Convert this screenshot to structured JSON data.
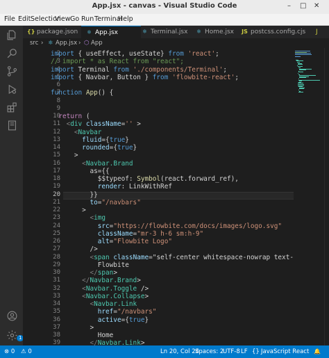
{
  "window": {
    "title": "App.jsx - canvas - Visual Studio Code",
    "minimize": "–",
    "maximize": "□",
    "close": "✕"
  },
  "menu": [
    "File",
    "Edit",
    "Selection",
    "View",
    "Go",
    "Run",
    "Terminal",
    "Help"
  ],
  "tabs": [
    {
      "label": "package.json",
      "icon": "{}",
      "color": "#cbcb41"
    },
    {
      "label": "App.jsx",
      "icon": "⚛",
      "color": "#61dafb",
      "active": true
    },
    {
      "label": "Terminal.jsx",
      "icon": "⚛",
      "color": "#61dafb"
    },
    {
      "label": "Home.jsx",
      "icon": "⚛",
      "color": "#61dafb"
    },
    {
      "label": "postcss.config.cjs",
      "icon": "JS",
      "color": "#cbcb41"
    },
    {
      "label": "J",
      "icon": "",
      "color": "#cbcb41"
    }
  ],
  "breadcrumb": {
    "folder": "src",
    "sep1": "›",
    "file_icon": "⚛",
    "file": "App.jsx",
    "sep2": "›",
    "symbol_icon": "⬡",
    "symbol": "App"
  },
  "editor": {
    "current_line": 20,
    "line_numbers": [
      "2",
      "3",
      "4",
      "5",
      "6",
      "7",
      "8",
      "9",
      "10",
      "11",
      "12",
      "13",
      "14",
      "15",
      "16",
      "17",
      "18",
      "19",
      "20",
      "21",
      "22",
      "23",
      "24",
      "25",
      "26",
      "27",
      "28",
      "29",
      "30",
      "31",
      "32",
      "33",
      "34",
      "35",
      "36",
      "37",
      "38",
      "39"
    ],
    "lines": [
      "import { useEffect, useState} from 'react';",
      "// import * as React from \"react\";",
      "import Terminal from './components/Terminal';",
      "import { Navbar, Button } from 'flowbite-react';",
      "",
      "function App() {",
      "",
      "",
      "  return (",
      "    <div className='' >",
      "      <Navbar",
      "        fluid={true}",
      "        rounded={true}",
      "      >",
      "        <Navbar.Brand",
      "          as={{",
      "            $$typeof: Symbol(react.forward_ref),",
      "            render: LinkWithRef",
      "          }}",
      "          to=\"/navbars\"",
      "        >",
      "          <img",
      "            src=\"https://flowbite.com/docs/images/logo.svg\"",
      "            className=\"mr-3 h-6 sm:h-9\"",
      "            alt=\"Flowbite Logo\"",
      "          />",
      "          <span className=\"self-center whitespace-nowrap text-xl font-se",
      "            Flowbite",
      "          </span>",
      "        </Navbar.Brand>",
      "        <Navbar.Toggle />",
      "        <Navbar.Collapse>",
      "          <Navbar.Link",
      "            href=\"/navbars\"",
      "            active={true}",
      "          >",
      "            Home",
      "          </Navbar.Link>",
      "          <Navbar.Link"
    ]
  },
  "status": {
    "errors": "⊗ 0",
    "warnings": "⚠ 0",
    "position": "Ln 20, Col 24",
    "spaces": "Spaces: 2",
    "encoding": "UTF-8",
    "eol": "LF",
    "braces": "{}",
    "language": "JavaScript React",
    "bell": "🔔",
    "badge": "1"
  },
  "colors": {
    "accent": "#007acc",
    "editor_bg": "#1e1e1e",
    "activity_bg": "#2c2c2c"
  }
}
